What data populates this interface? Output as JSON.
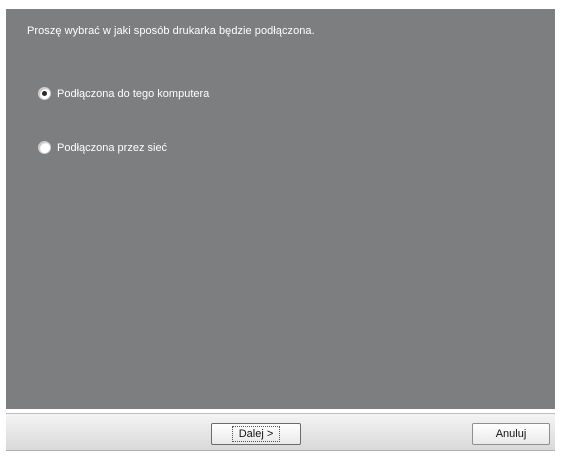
{
  "instruction": "Proszę wybrać w jaki sposób drukarka będzie podłączona.",
  "options": [
    {
      "label": "Podłączona do tego komputera",
      "selected": true
    },
    {
      "label": "Podłączona przez sieć",
      "selected": false
    }
  ],
  "buttons": {
    "next_label": "Dalej >",
    "cancel_label": "Anuluj"
  },
  "colors": {
    "panel_bg": "#7d7e80",
    "text": "#ffffff"
  }
}
